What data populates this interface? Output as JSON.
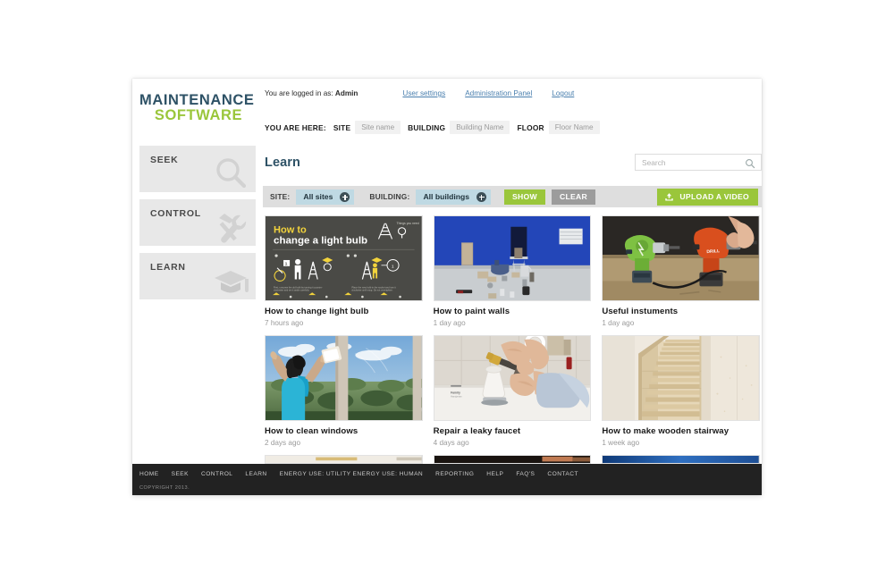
{
  "brand": {
    "line1": "MAINTENANCE",
    "line2": "SOFTWARE",
    "color1": "#2e5266",
    "color2": "#9ac63b"
  },
  "sidebar": {
    "items": [
      {
        "label": "SEEK",
        "icon": "magnifier-icon"
      },
      {
        "label": "CONTROL",
        "icon": "hammer-wrench-icon"
      },
      {
        "label": "LEARN",
        "icon": "graduation-cap-icon"
      }
    ]
  },
  "topbar": {
    "logged_in_prefix": "You are logged in as:",
    "user": "Admin",
    "links": [
      {
        "label": "User settings"
      },
      {
        "label": "Administration Panel"
      },
      {
        "label": "Logout"
      }
    ]
  },
  "breadcrumb": {
    "label": "YOU ARE HERE:",
    "items": [
      {
        "key": "SITE",
        "value": "Site name"
      },
      {
        "key": "BUILDING",
        "value": "Building Name"
      },
      {
        "key": "FLOOR",
        "value": "Floor Name"
      }
    ]
  },
  "page": {
    "title": "Learn"
  },
  "search": {
    "placeholder": "Search",
    "value": ""
  },
  "filters": {
    "site_label": "SITE:",
    "site_value": "All sites",
    "building_label": "BUILDING:",
    "building_value": "All buildings",
    "show_label": "SHOW",
    "clear_label": "CLEAR",
    "upload_label": "UPLOAD A VIDEO",
    "accent_green": "#9ac63b",
    "pill_blue": "#bfd9e3",
    "bar_grey": "#dedede"
  },
  "videos": [
    {
      "title": "How to change light bulb",
      "time": "7 hours ago",
      "thumb": "lightbulb-infographic"
    },
    {
      "title": "How to paint walls",
      "time": "1 day ago",
      "thumb": "blue-room-painting"
    },
    {
      "title": "Useful instuments",
      "time": "1 day ago",
      "thumb": "cordless-drills"
    },
    {
      "title": "How to clean windows",
      "time": "2 days ago",
      "thumb": "woman-cleaning-window"
    },
    {
      "title": "Repair a leaky faucet",
      "time": "4 days ago",
      "thumb": "hands-fixing-faucet"
    },
    {
      "title": "How to make wooden stairway",
      "time": "1 week ago",
      "thumb": "wooden-staircase"
    }
  ],
  "thumb_texts": {
    "lightbulb_line1": "How to",
    "lightbulb_line2": "change a light bulb",
    "lightbulb_note": "Things you need"
  },
  "footer": {
    "links": [
      "HOME",
      "SEEK",
      "CONTROL",
      "LEARN",
      "ENERGY USE: UTILITY",
      "ENERGY USE: HUMAN",
      "REPORTING",
      "HELP",
      "FAQ'S",
      "CONTACT"
    ],
    "copyright": "COPYRIGHT 2013."
  }
}
